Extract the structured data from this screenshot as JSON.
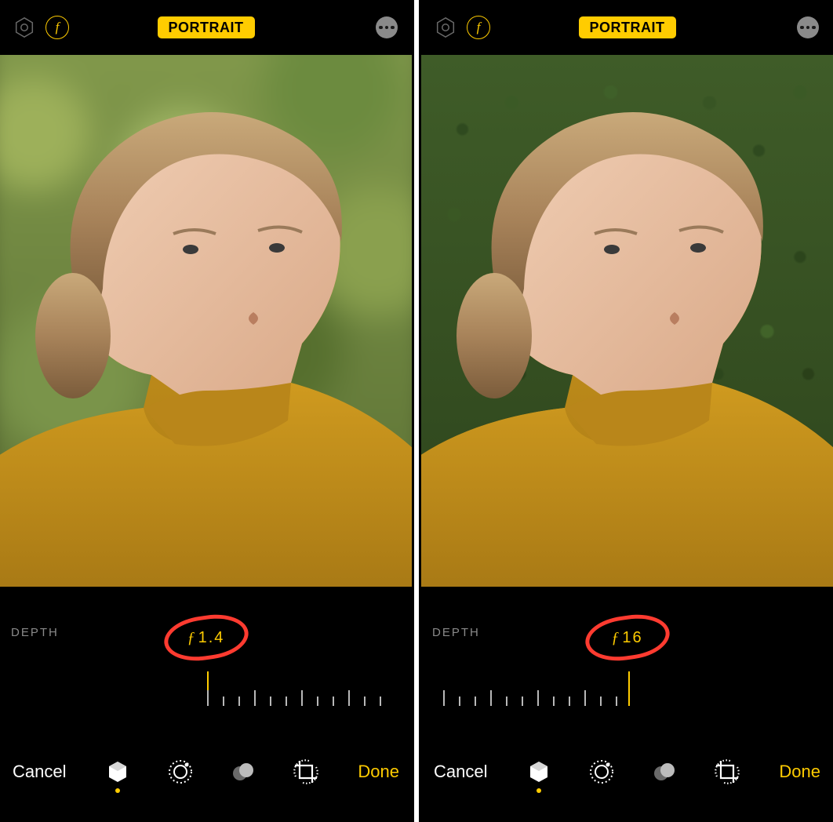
{
  "panes": [
    {
      "id": "left",
      "topbar": {
        "mode_badge": "PORTRAIT",
        "aperture_icon_label": "f",
        "live_icon_name": "live-photo-icon",
        "more_icon_name": "more-icon"
      },
      "depth": {
        "label": "DEPTH",
        "f_prefix": "ƒ",
        "f_value": "1.4",
        "annotation_color": "#ff3b30"
      },
      "slider": {
        "indicator_position": "left",
        "tick_count": 12
      },
      "toolbar": {
        "cancel_label": "Cancel",
        "done_label": "Done",
        "tools": [
          {
            "name": "portrait-tool",
            "active": true
          },
          {
            "name": "adjust-tool",
            "active": false
          },
          {
            "name": "filters-tool",
            "active": false
          },
          {
            "name": "crop-tool",
            "active": false
          }
        ]
      }
    },
    {
      "id": "right",
      "topbar": {
        "mode_badge": "PORTRAIT",
        "aperture_icon_label": "f",
        "live_icon_name": "live-photo-icon",
        "more_icon_name": "more-icon"
      },
      "depth": {
        "label": "DEPTH",
        "f_prefix": "ƒ",
        "f_value": "16",
        "annotation_color": "#ff3b30"
      },
      "slider": {
        "indicator_position": "right",
        "tick_count": 12
      },
      "toolbar": {
        "cancel_label": "Cancel",
        "done_label": "Done",
        "tools": [
          {
            "name": "portrait-tool",
            "active": true
          },
          {
            "name": "adjust-tool",
            "active": false
          },
          {
            "name": "filters-tool",
            "active": false
          },
          {
            "name": "crop-tool",
            "active": false
          }
        ]
      }
    }
  ],
  "colors": {
    "accent": "#ffcc00",
    "annotation": "#ff3b30",
    "muted": "#8a8a8a"
  }
}
